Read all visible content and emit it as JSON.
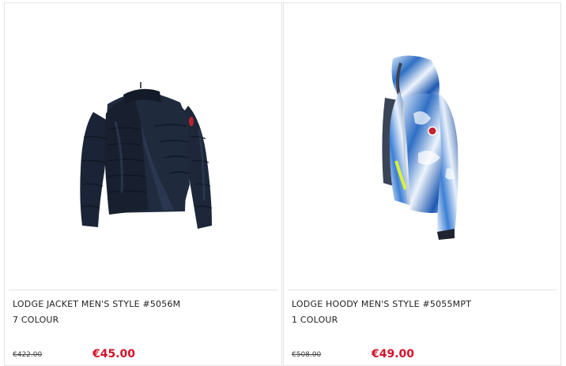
{
  "products": [
    {
      "title": "LODGE JACKET MEN'S STYLE #5056M",
      "colours": "7 COLOUR",
      "old_price": "€422.00",
      "new_price": "€45.00",
      "image_icon": "navy-down-jacket-image"
    },
    {
      "title": "LODGE HOODY MEN'S STYLE #5055MPT",
      "colours": "1 COLOUR",
      "old_price": "€508.00",
      "new_price": "€49.00",
      "image_icon": "blue-print-hoody-image"
    }
  ],
  "colors": {
    "price_red": "#d0142b",
    "jacket_navy": "#1b2436",
    "hoody_blue": "#2f6fc4",
    "border": "#e4e4e4"
  }
}
